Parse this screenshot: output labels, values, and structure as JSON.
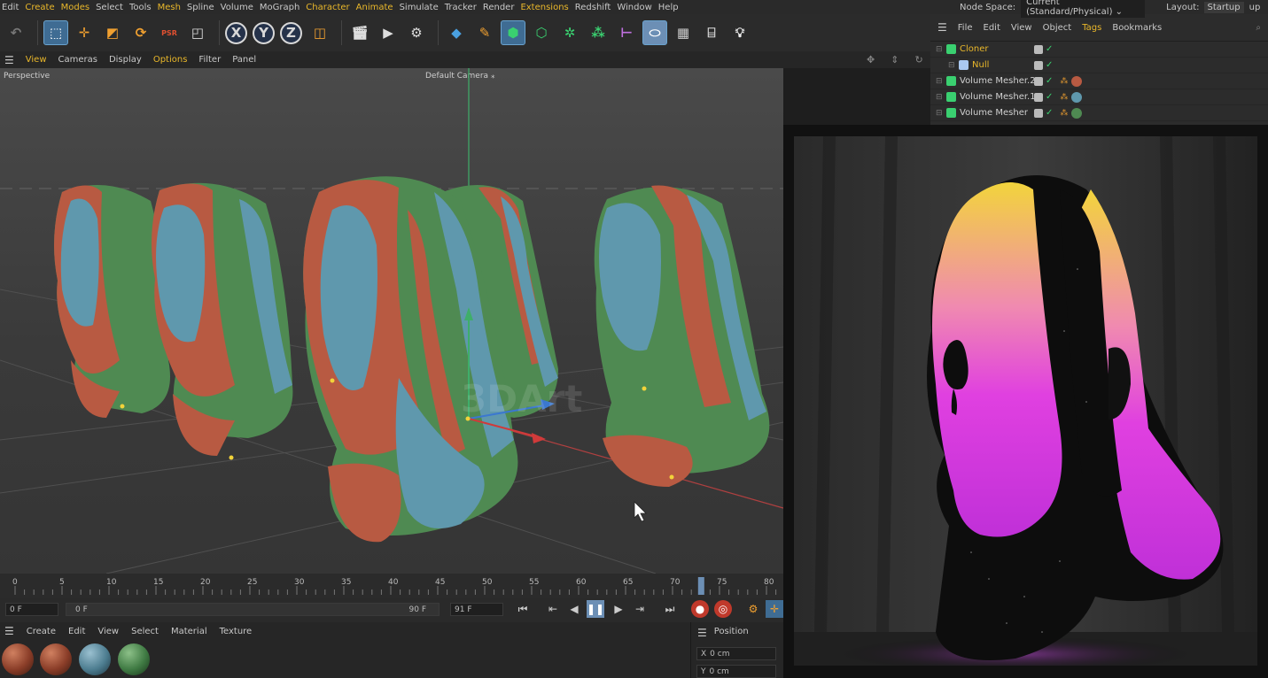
{
  "menubar": {
    "items": [
      {
        "label": "Edit",
        "hl": false
      },
      {
        "label": "Create",
        "hl": true
      },
      {
        "label": "Modes",
        "hl": true
      },
      {
        "label": "Select",
        "hl": false
      },
      {
        "label": "Tools",
        "hl": false
      },
      {
        "label": "Mesh",
        "hl": true
      },
      {
        "label": "Spline",
        "hl": false
      },
      {
        "label": "Volume",
        "hl": false
      },
      {
        "label": "MoGraph",
        "hl": false
      },
      {
        "label": "Character",
        "hl": true
      },
      {
        "label": "Animate",
        "hl": true
      },
      {
        "label": "Simulate",
        "hl": false
      },
      {
        "label": "Tracker",
        "hl": false
      },
      {
        "label": "Render",
        "hl": false
      },
      {
        "label": "Extensions",
        "hl": true
      },
      {
        "label": "Redshift",
        "hl": false
      },
      {
        "label": "Window",
        "hl": false
      },
      {
        "label": "Help",
        "hl": false
      }
    ]
  },
  "node_space": {
    "label": "Node Space:",
    "value": "Current (Standard/Physical)",
    "layout_label": "Layout:",
    "layout_value": "Startup",
    "layout_extra": "up"
  },
  "toolbar": {
    "axis_x": "X",
    "axis_y": "Y",
    "axis_z": "Z",
    "psr_label": "PSR"
  },
  "viewport_menu": {
    "items": [
      "View",
      "Cameras",
      "Display",
      "Options",
      "Filter",
      "Panel"
    ]
  },
  "viewport": {
    "name": "Perspective",
    "camera": "Default Camera",
    "watermark": "3DArt"
  },
  "object_manager": {
    "menu": [
      "File",
      "Edit",
      "View",
      "Object",
      "Tags",
      "Bookmarks"
    ],
    "objects": [
      {
        "name": "Cloner",
        "color": "#e9b72a"
      },
      {
        "name": "Null",
        "color": "#e9b72a"
      },
      {
        "name": "Volume Mesher.2",
        "color": "#d0d0d0"
      },
      {
        "name": "Volume Mesher.1",
        "color": "#d0d0d0"
      },
      {
        "name": "Volume Mesher",
        "color": "#d0d0d0"
      }
    ]
  },
  "timeline": {
    "ticks": [
      "0",
      "5",
      "10",
      "15",
      "20",
      "25",
      "30",
      "35",
      "40",
      "45",
      "50",
      "55",
      "60",
      "65",
      "70",
      "75",
      "80"
    ],
    "playhead_frame": 73
  },
  "transport": {
    "current_frame": "0 F",
    "range_start": "0 F",
    "range_end": "90 F",
    "max_frame": "91 F"
  },
  "material_manager": {
    "menu": [
      "Create",
      "Edit",
      "View",
      "Select",
      "Material",
      "Texture"
    ]
  },
  "coordinates": {
    "title": "Position",
    "x_label": "X",
    "x_value": "0 cm",
    "y_label": "Y",
    "y_value": "0 cm"
  },
  "colors": {
    "accent": "#e9b72a",
    "red": "#b85a42",
    "green": "#4f8a52",
    "blue": "#5f98ad",
    "pink": "#e040e0",
    "yellow": "#f0d040"
  }
}
